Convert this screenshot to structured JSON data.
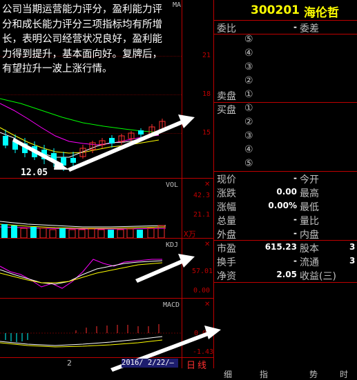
{
  "stock": {
    "code": "300201",
    "name": "海伦哲"
  },
  "annotation": "公司当期运营能力评分，盈利能力评分和成长能力评分三项指标均有所增长，表明公司经营状况良好，盈利能力得到提升，基本面向好。复牌后，有望拉升一波上涨行情。",
  "price_chart": {
    "ma_label": "MA",
    "axis_ticks": [
      "21",
      "18",
      "15"
    ],
    "low_price": "12.05"
  },
  "volume_panel": {
    "title": "VOL",
    "ticks": [
      "42.3",
      "21.1"
    ],
    "unit": "X万"
  },
  "kdj_panel": {
    "title": "KDJ",
    "ticks": [
      "57.01",
      "0.00"
    ]
  },
  "macd_panel": {
    "title": "MACD",
    "ticks": [
      "0.00",
      "-1.43"
    ]
  },
  "bottom_bar": {
    "period_value": "2",
    "date": "2016/ 2/22/—",
    "period_type": "日线"
  },
  "order_book": {
    "ratio_label": "委比",
    "ratio_value": "-",
    "diff_label": "委差",
    "sell_label": "卖盘",
    "buy_label": "买盘",
    "levels_sell": [
      "⑤",
      "④",
      "③",
      "②",
      "①"
    ],
    "levels_buy": [
      "①",
      "②",
      "③",
      "④",
      "⑤"
    ]
  },
  "quote": {
    "rows": [
      {
        "l1": "现价",
        "v1": "-",
        "l2": "今开"
      },
      {
        "l1": "涨跌",
        "v1": "0.00",
        "l2": "最高"
      },
      {
        "l1": "涨幅",
        "v1": "0.00%",
        "l2": "最低"
      },
      {
        "l1": "总量",
        "v1": "-",
        "l2": "量比"
      },
      {
        "l1": "外盘",
        "v1": "-",
        "l2": "内盘"
      }
    ],
    "rows2": [
      {
        "l1": "市盈",
        "v1": "615.23",
        "l2": "股本",
        "v2": "3"
      },
      {
        "l1": "换手",
        "v1": "-",
        "l2": "流通",
        "v2": "3"
      },
      {
        "l1": "净资",
        "v1": "2.05",
        "l2": "收益(三)",
        "v2": ""
      }
    ]
  },
  "bottom_tabs": [
    "细",
    "指",
    "势",
    "时"
  ],
  "colors": {
    "up": "#ff3030",
    "down": "#00ffff",
    "grid": "#c00000",
    "ma5": "#ffffff",
    "ma10": "#ffff00",
    "ma20": "#ff00ff",
    "ma60": "#00ff00"
  }
}
